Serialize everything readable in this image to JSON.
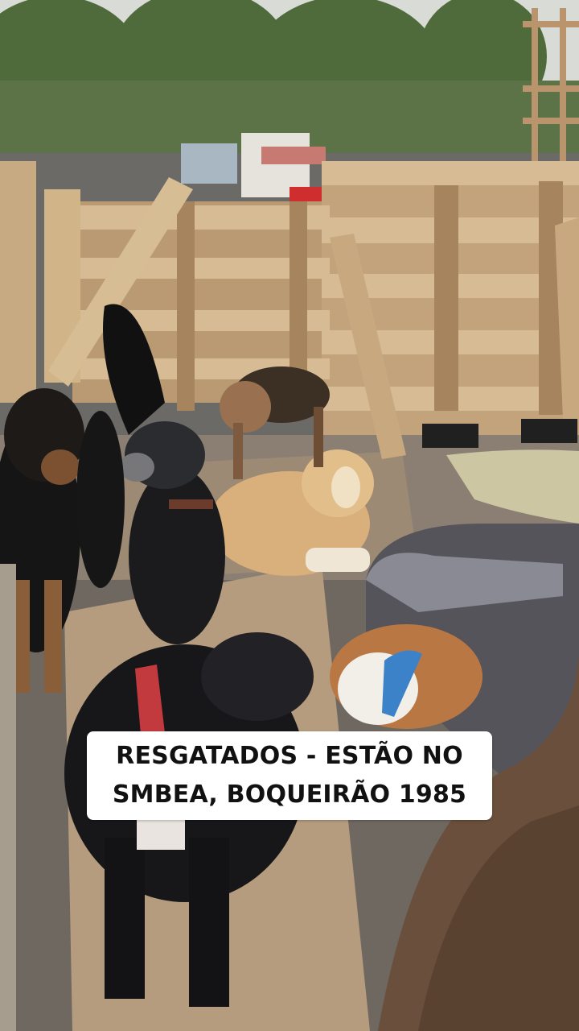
{
  "caption": {
    "line1": "RESGATADOS - ESTÃO NO",
    "line2": "SMBEA, BOQUEIRÃO 1985"
  },
  "colors": {
    "sky": "#d9dcd6",
    "trees": "#4f6b3c",
    "wood": "#c4a47a",
    "ground": "#8a7f72",
    "caption_bg": "#ffffff",
    "caption_text": "#111111"
  }
}
